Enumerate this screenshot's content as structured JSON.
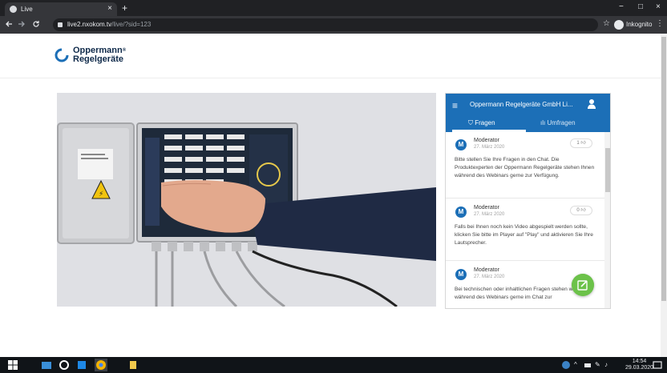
{
  "browser": {
    "tab_title": "Live",
    "tab_close": "×",
    "new_tab": "+",
    "url_host": "live2.nxokom.tv",
    "url_path": "/live/?sid=123",
    "incognito_label": "Inkognito",
    "window_controls": [
      "−",
      "□",
      "×"
    ],
    "nav_icons": [
      "back-icon",
      "forward-icon",
      "reload-icon"
    ]
  },
  "brand": {
    "line1": "Oppermann",
    "reg": "®",
    "line2": "Regelgeräte",
    "color": "#1c6fb7"
  },
  "chat": {
    "title": "Oppermann Regelgeräte GmbH Li...",
    "tabs": [
      {
        "label": "Fragen",
        "icon": "question-icon",
        "active": true
      },
      {
        "label": "Umfragen",
        "icon": "chart-icon",
        "active": false
      }
    ],
    "accent": "#1c6fb7",
    "messages": [
      {
        "avatar": "M",
        "name": "Moderator",
        "date": "27. März 2020",
        "likes": "1",
        "text": "Bitte stellen Sie Ihre Fragen in den Chat. Die Produktexperten der Oppermann Regelgeräte stehen Ihnen während des Webinars gerne zur Verfügung."
      },
      {
        "avatar": "M",
        "name": "Moderator",
        "date": "27. März 2020",
        "likes": "0",
        "text": "Falls bei Ihnen noch kein Video abgespielt werden sollte, klicken Sie bitte im Player auf \"Play\" und aktivieren Sie Ihre Lautsprecher."
      },
      {
        "avatar": "M",
        "name": "Moderator",
        "date": "27. März 2020",
        "likes": "",
        "text": "Bei technischen oder inhaltlichen Fragen stehen wir Ihnen während des Webinars gerne im Chat zur"
      }
    ],
    "fab_color": "#6cc24a"
  },
  "taskbar": {
    "time": "14:54",
    "date": "29.03.2020",
    "tray_icons": [
      "network-icon",
      "volume-icon",
      "language-icon"
    ]
  }
}
